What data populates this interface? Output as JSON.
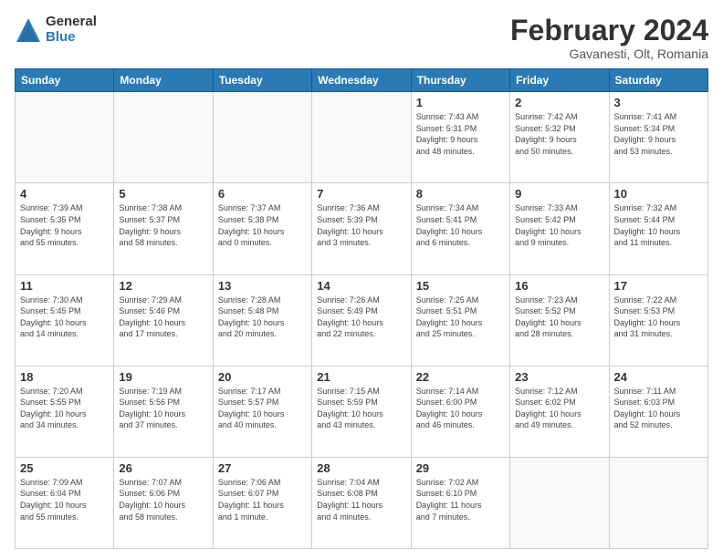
{
  "logo": {
    "general": "General",
    "blue": "Blue"
  },
  "header": {
    "title": "February 2024",
    "subtitle": "Gavanesti, Olt, Romania"
  },
  "days_of_week": [
    "Sunday",
    "Monday",
    "Tuesday",
    "Wednesday",
    "Thursday",
    "Friday",
    "Saturday"
  ],
  "weeks": [
    [
      {
        "day": "",
        "info": ""
      },
      {
        "day": "",
        "info": ""
      },
      {
        "day": "",
        "info": ""
      },
      {
        "day": "",
        "info": ""
      },
      {
        "day": "1",
        "info": "Sunrise: 7:43 AM\nSunset: 5:31 PM\nDaylight: 9 hours\nand 48 minutes."
      },
      {
        "day": "2",
        "info": "Sunrise: 7:42 AM\nSunset: 5:32 PM\nDaylight: 9 hours\nand 50 minutes."
      },
      {
        "day": "3",
        "info": "Sunrise: 7:41 AM\nSunset: 5:34 PM\nDaylight: 9 hours\nand 53 minutes."
      }
    ],
    [
      {
        "day": "4",
        "info": "Sunrise: 7:39 AM\nSunset: 5:35 PM\nDaylight: 9 hours\nand 55 minutes."
      },
      {
        "day": "5",
        "info": "Sunrise: 7:38 AM\nSunset: 5:37 PM\nDaylight: 9 hours\nand 58 minutes."
      },
      {
        "day": "6",
        "info": "Sunrise: 7:37 AM\nSunset: 5:38 PM\nDaylight: 10 hours\nand 0 minutes."
      },
      {
        "day": "7",
        "info": "Sunrise: 7:36 AM\nSunset: 5:39 PM\nDaylight: 10 hours\nand 3 minutes."
      },
      {
        "day": "8",
        "info": "Sunrise: 7:34 AM\nSunset: 5:41 PM\nDaylight: 10 hours\nand 6 minutes."
      },
      {
        "day": "9",
        "info": "Sunrise: 7:33 AM\nSunset: 5:42 PM\nDaylight: 10 hours\nand 9 minutes."
      },
      {
        "day": "10",
        "info": "Sunrise: 7:32 AM\nSunset: 5:44 PM\nDaylight: 10 hours\nand 11 minutes."
      }
    ],
    [
      {
        "day": "11",
        "info": "Sunrise: 7:30 AM\nSunset: 5:45 PM\nDaylight: 10 hours\nand 14 minutes."
      },
      {
        "day": "12",
        "info": "Sunrise: 7:29 AM\nSunset: 5:46 PM\nDaylight: 10 hours\nand 17 minutes."
      },
      {
        "day": "13",
        "info": "Sunrise: 7:28 AM\nSunset: 5:48 PM\nDaylight: 10 hours\nand 20 minutes."
      },
      {
        "day": "14",
        "info": "Sunrise: 7:26 AM\nSunset: 5:49 PM\nDaylight: 10 hours\nand 22 minutes."
      },
      {
        "day": "15",
        "info": "Sunrise: 7:25 AM\nSunset: 5:51 PM\nDaylight: 10 hours\nand 25 minutes."
      },
      {
        "day": "16",
        "info": "Sunrise: 7:23 AM\nSunset: 5:52 PM\nDaylight: 10 hours\nand 28 minutes."
      },
      {
        "day": "17",
        "info": "Sunrise: 7:22 AM\nSunset: 5:53 PM\nDaylight: 10 hours\nand 31 minutes."
      }
    ],
    [
      {
        "day": "18",
        "info": "Sunrise: 7:20 AM\nSunset: 5:55 PM\nDaylight: 10 hours\nand 34 minutes."
      },
      {
        "day": "19",
        "info": "Sunrise: 7:19 AM\nSunset: 5:56 PM\nDaylight: 10 hours\nand 37 minutes."
      },
      {
        "day": "20",
        "info": "Sunrise: 7:17 AM\nSunset: 5:57 PM\nDaylight: 10 hours\nand 40 minutes."
      },
      {
        "day": "21",
        "info": "Sunrise: 7:15 AM\nSunset: 5:59 PM\nDaylight: 10 hours\nand 43 minutes."
      },
      {
        "day": "22",
        "info": "Sunrise: 7:14 AM\nSunset: 6:00 PM\nDaylight: 10 hours\nand 46 minutes."
      },
      {
        "day": "23",
        "info": "Sunrise: 7:12 AM\nSunset: 6:02 PM\nDaylight: 10 hours\nand 49 minutes."
      },
      {
        "day": "24",
        "info": "Sunrise: 7:11 AM\nSunset: 6:03 PM\nDaylight: 10 hours\nand 52 minutes."
      }
    ],
    [
      {
        "day": "25",
        "info": "Sunrise: 7:09 AM\nSunset: 6:04 PM\nDaylight: 10 hours\nand 55 minutes."
      },
      {
        "day": "26",
        "info": "Sunrise: 7:07 AM\nSunset: 6:06 PM\nDaylight: 10 hours\nand 58 minutes."
      },
      {
        "day": "27",
        "info": "Sunrise: 7:06 AM\nSunset: 6:07 PM\nDaylight: 11 hours\nand 1 minute."
      },
      {
        "day": "28",
        "info": "Sunrise: 7:04 AM\nSunset: 6:08 PM\nDaylight: 11 hours\nand 4 minutes."
      },
      {
        "day": "29",
        "info": "Sunrise: 7:02 AM\nSunset: 6:10 PM\nDaylight: 11 hours\nand 7 minutes."
      },
      {
        "day": "",
        "info": ""
      },
      {
        "day": "",
        "info": ""
      }
    ]
  ]
}
